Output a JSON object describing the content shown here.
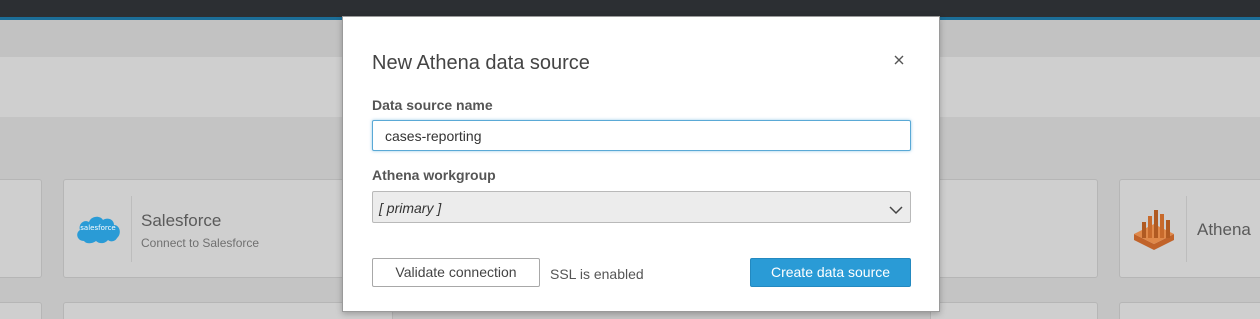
{
  "background": {
    "cards": [
      {
        "title": "Salesforce",
        "subtitle": "Connect to Salesforce",
        "logo_text": "salesforce",
        "icon": "salesforce-cloud-icon"
      },
      {
        "title": "Athena",
        "icon": "athena-icon"
      }
    ]
  },
  "modal": {
    "title": "New Athena data source",
    "close_icon": "close-icon",
    "name_label": "Data source name",
    "name_value": "cases-reporting",
    "workgroup_label": "Athena workgroup",
    "workgroup_value": "[ primary ]",
    "workgroup_icon": "chevron-down-icon",
    "validate_label": "Validate connection",
    "ssl_text": "SSL is enabled",
    "create_label": "Create data source"
  },
  "colors": {
    "accent": "#2a9bd6",
    "topbar": "#2c2f33",
    "input_focus": "#5aa9d6"
  }
}
